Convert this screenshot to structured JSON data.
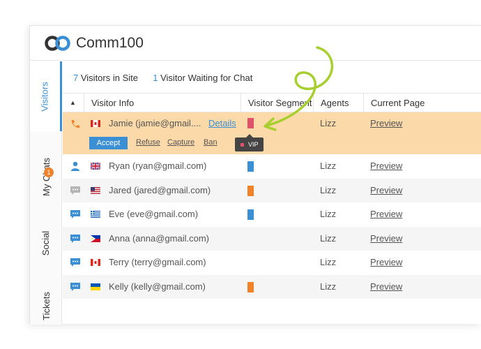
{
  "app": {
    "brand": "Comm100"
  },
  "sidebar": {
    "tabs": [
      {
        "label": "Visitors",
        "active": true
      },
      {
        "label": "My Chats",
        "badge": "1"
      },
      {
        "label": "Social"
      },
      {
        "label": "Tickets"
      }
    ]
  },
  "summary": {
    "visitors_count": "7",
    "visitors_label": "Visitors in Site",
    "waiting_count": "1",
    "waiting_label": "Visitor Waiting for Chat"
  },
  "table": {
    "sort_indicator": "▲",
    "columns": [
      "Visitor Info",
      "Visitor Segment",
      "Agents",
      "Current Page"
    ],
    "rows": [
      {
        "icon": "phone-icon",
        "flag": "ca",
        "name": "Jamie (jamie@gmail....",
        "details": "Details",
        "segment_color": "#e0526a",
        "agent": "Lizz",
        "page": "Preview",
        "selected": true
      },
      {
        "icon": "person-icon",
        "flag": "gb",
        "name": "Ryan (ryan@gmail.com)",
        "segment_color": "#3a8fd5",
        "agent": "Lizz",
        "page": "Preview"
      },
      {
        "icon": "chat-grey-icon",
        "flag": "us",
        "name": "Jared (jared@gmail.com)",
        "segment_color": "#f0822a",
        "agent": "Lizz",
        "page": "Preview"
      },
      {
        "icon": "chat-blue-icon",
        "flag": "gr",
        "name": "Eve (eve@gmail.com)",
        "segment_color": "#3a8fd5",
        "agent": "Lizz",
        "page": "Preview"
      },
      {
        "icon": "chat-blue-icon",
        "flag": "ph",
        "name": "Anna (anna@gmail.com)",
        "agent": "Lizz",
        "page": "Preview"
      },
      {
        "icon": "chat-blue-icon",
        "flag": "ca",
        "name": "Terry (terry@gmail.com)",
        "agent": "Lizz",
        "page": "Preview"
      },
      {
        "icon": "chat-blue-icon",
        "flag": "ua",
        "name": "Kelly (kelly@gmail.com)",
        "segment_color": "#f0822a",
        "agent": "Lizz",
        "page": "Preview"
      }
    ],
    "actions": {
      "accept": "Accept",
      "refuse": "Refuse",
      "capture": "Capture",
      "ban": "Ban"
    },
    "tooltip": "VIP"
  },
  "colors": {
    "accent": "#3a8fd5",
    "selected_row": "#fbd9a8",
    "vip": "#e0526a",
    "orange": "#f0822a",
    "annotation": "#a6cf2f"
  }
}
